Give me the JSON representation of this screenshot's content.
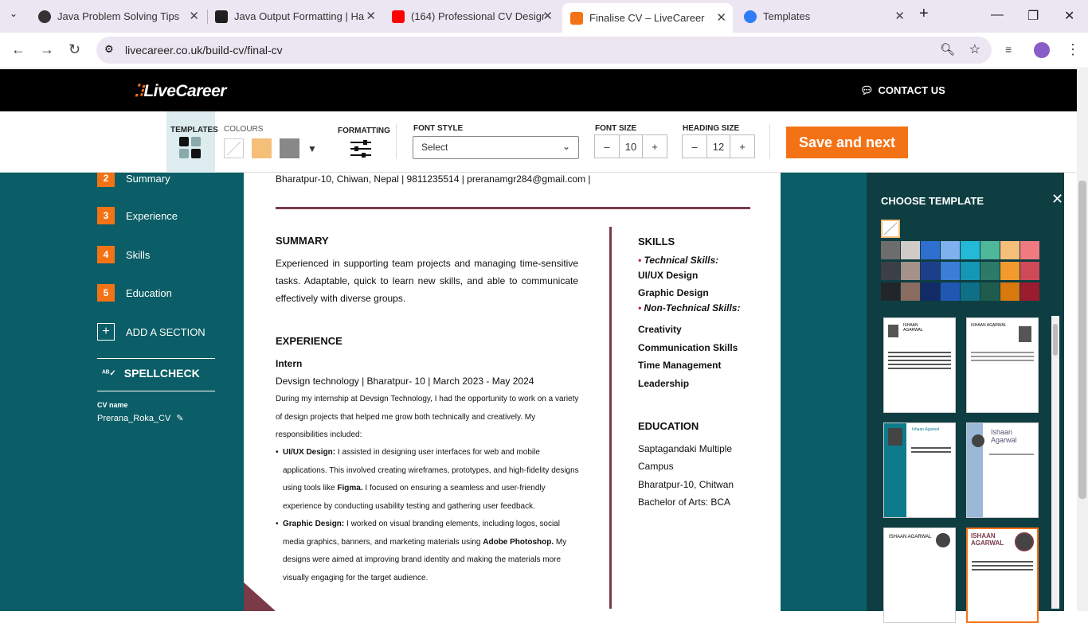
{
  "browser": {
    "tabs": [
      {
        "title": "Java Problem Solving Tips",
        "color": "#333333"
      },
      {
        "title": "Java Output Formatting | Ha",
        "color": "#1f1f1f"
      },
      {
        "title": "(164) Professional CV Design",
        "color": "#ff0000"
      },
      {
        "title": "Finalise CV – LiveCareer",
        "color": "#f47216"
      },
      {
        "title": "Templates",
        "color": "#2e7df6"
      }
    ],
    "url": "livecareer.co.uk/build-cv/final-cv"
  },
  "header": {
    "logo": "LiveCareer",
    "contact": "CONTACT US"
  },
  "toolbar": {
    "templates": "TEMPLATES",
    "colours": "COLOURS",
    "formatting": "FORMATTING",
    "font_style": "FONT STYLE",
    "font_select": "Select",
    "font_size": "FONT SIZE",
    "font_size_value": "10",
    "heading_size": "HEADING SIZE",
    "heading_size_value": "12",
    "save": "Save and next",
    "swatch_colors": [
      "#ffffff",
      "#f5bf7a",
      "#888888"
    ]
  },
  "sidebar": {
    "steps": [
      {
        "n": "2",
        "label": "Summary"
      },
      {
        "n": "3",
        "label": "Experience"
      },
      {
        "n": "4",
        "label": "Skills"
      },
      {
        "n": "5",
        "label": "Education"
      }
    ],
    "add_section": "ADD A SECTION",
    "spellcheck": "SPELLCHECK",
    "cv_name_label": "CV name",
    "cv_name": "Prerana_Roka_CV"
  },
  "cv": {
    "contact": "Bharatpur-10, Chiwan, Nepal  |  9811235514  |  preranamgr284@gmail.com  |",
    "summary_title": "SUMMARY",
    "summary": "Experienced in supporting team projects and managing time-sensitive tasks. Adaptable, quick to learn new skills, and able to communicate effectively with diverse groups.",
    "experience_title": "EXPERIENCE",
    "job_title": "Intern",
    "job_meta": "Devsign technology | Bharatpur- 10 | March 2023 - May 2024",
    "job_intro": "During my internship at Devsign Technology, I had the opportunity to work on a variety of design projects that helped me grow both technically and creatively. My responsibilities included:",
    "b1_head": "UI/UX Design:",
    "b1_a": " I assisted in designing user interfaces for web and mobile applications. This involved creating wireframes, prototypes, and high-fidelity designs using tools like ",
    "b1_bold": "Figma.",
    "b1_b": " I focused on ensuring a seamless and user-friendly experience by conducting usability testing and gathering user feedback.",
    "b2_head": "Graphic Design:",
    "b2_a": " I worked on visual branding elements, including logos, social media graphics, banners, and marketing materials using ",
    "b2_bold": "Adobe Photoshop.",
    "b2_b": " My designs were aimed at improving brand identity and making the materials more visually engaging for the target audience.",
    "skills_title": "SKILLS",
    "tech_label": "Technical Skills:",
    "tech": [
      "UI/UX Design",
      "Graphic Design"
    ],
    "nontech_label": "Non-Technical Skills:",
    "nontech": [
      "Creativity",
      "Communication Skills",
      "Time Management",
      "Leadership"
    ],
    "education_title": "EDUCATION",
    "edu": [
      "Saptagandaki Multiple",
      "Campus",
      "Bharatpur-10, Chitwan",
      "Bachelor of Arts: BCA"
    ]
  },
  "panel": {
    "title": "CHOOSE TEMPLATE",
    "thumb_names": [
      "ISHAAN AGARWAL",
      "ISHAAN AGARWAL",
      "Ishaan Agarwal",
      "Ishaan Agarwal",
      "ISHAAN AGARWAL",
      "ISHAAN AGARWAL"
    ],
    "colors": [
      [
        "#6d6d6d",
        "#d0cbc8",
        "#2e6fcf",
        "#7fb0ef",
        "#24b9d6",
        "#4fb79a",
        "#f5bf7a",
        "#f07a80"
      ],
      [
        "#3d3f46",
        "#a3918a",
        "#1d3f8a",
        "#3a7ed8",
        "#1497b4",
        "#2c7a67",
        "#f29a2e",
        "#cf4a56"
      ],
      [
        "#22252a",
        "#8a6b60",
        "#122a66",
        "#1f57b3",
        "#0f6f86",
        "#1f5c4d",
        "#d8780f",
        "#9b1c2e"
      ]
    ]
  }
}
